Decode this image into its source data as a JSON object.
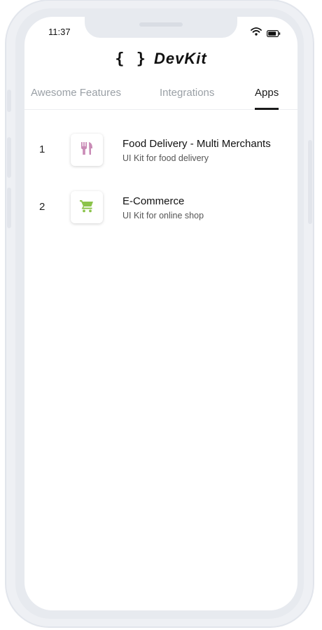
{
  "status_bar": {
    "time": "11:37"
  },
  "brand": {
    "braces": "{ }",
    "name": "DevKit"
  },
  "tabs": [
    {
      "label": "Awesome Features",
      "active": false
    },
    {
      "label": "Integrations",
      "active": false
    },
    {
      "label": "Apps",
      "active": true
    }
  ],
  "apps": [
    {
      "index": "1",
      "title": "Food Delivery - Multi Merchants",
      "subtitle": "UI Kit for food delivery",
      "icon": "fork-knife-icon",
      "color": "#c98bb6"
    },
    {
      "index": "2",
      "title": "E-Commerce",
      "subtitle": "UI Kit for online shop",
      "icon": "shopping-cart-icon",
      "color": "#8bc34a"
    }
  ]
}
